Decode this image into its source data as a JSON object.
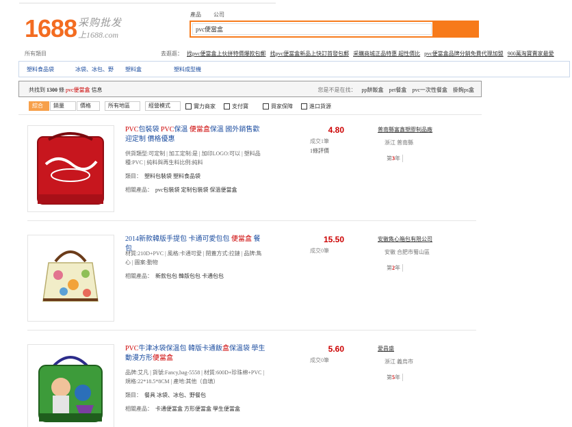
{
  "logo": {
    "number": "1688",
    "tagline": "采购批发",
    "domain": "上1688.com"
  },
  "search": {
    "tabs": [
      "產品",
      "公司"
    ],
    "query": "pvc便當盒"
  },
  "all_categories": "所有類目",
  "suggestions": {
    "label": "去逛逛：",
    "links": [
      "找pvc便當盒上伙拼特價爆款包郵",
      "找pvc便當盒新品上快訂首發包郵",
      "采購商城正品特惠 超性價比",
      "pvc便當盒品牌分銷免費代理加盟",
      "900萬淘寶賣家最愛"
    ]
  },
  "category_bar": [
    "塑料食品袋",
    "冰袋、冰包、野",
    "塑料盒",
    "塑料成型機"
  ],
  "results": {
    "prefix": "共找到",
    "count": "1300",
    "unit": "條",
    "keyword": "pvc便當盒",
    "suffix": "信息",
    "alt_label": "您是不是在找：",
    "alt_links": [
      "pp餅飯盒",
      "pet餐盒",
      "pvc一次性餐盒",
      "掛鉤ps盒"
    ]
  },
  "filters": {
    "buttons": [
      "綜合",
      "銷量",
      "價格",
      "所有地區",
      "經營模式"
    ],
    "checks": [
      "實力商家",
      "支付寶",
      "買家保障",
      "進口貨源"
    ]
  },
  "items": [
    {
      "title_parts": [
        {
          "t": "PVC",
          "hl": true
        },
        {
          "t": "包裝袋 ",
          "hl": false
        },
        {
          "t": "PVC",
          "hl": true
        },
        {
          "t": "保溫 ",
          "hl": false
        },
        {
          "t": "便當盒",
          "hl": true
        },
        {
          "t": "保溫 國外銷售歡迎定制 價格優惠",
          "hl": false
        }
      ],
      "attrs": "供貨類型:可定制 | 加工定制:是 | 加印LOGO:可以 | 塑料品種:PVC | 純料與再生料比例:純料",
      "kind_label": "類目：",
      "kind": "塑料包裝袋 塑料食品袋",
      "rel_label": "相關產品：",
      "rel": "pvc包裝袋 定制包裝袋 保溫便當盒",
      "price": "4.80",
      "deal": "成交1筆",
      "review": "1條評價",
      "company": "普南縣富鑫塑膠制品廠",
      "location": "浙江 普南縣",
      "years_prefix": "第",
      "years": "3",
      "years_suffix": "年"
    },
    {
      "title_parts": [
        {
          "t": "2014新款韓版手提包 卡通可愛包包 ",
          "hl": false
        },
        {
          "t": "便當盒",
          "hl": true
        },
        {
          "t": " 餐包",
          "hl": false
        }
      ],
      "attrs": "材質:210D+PVC | 風格:卡通可愛 | 閉蓋方式:拉鏈 | 品牌:雋心 | 圖案:動物",
      "kind_label": "",
      "kind": "",
      "rel_label": "相關產品：",
      "rel": "新款包包 韓版包包 卡通包包",
      "price": "15.50",
      "deal": "成交0筆",
      "review": "",
      "company": "安徽雋心箱包有限公司",
      "location": "安徽 合肥市蜀山區",
      "years_prefix": "第",
      "years": "2",
      "years_suffix": "年"
    },
    {
      "title_parts": [
        {
          "t": "PVC",
          "hl": true
        },
        {
          "t": "牛津冰袋保溫包 韓版卡通飯",
          "hl": false
        },
        {
          "t": "盒",
          "hl": true
        },
        {
          "t": "保溫袋 學生動漫方形",
          "hl": false
        },
        {
          "t": "便當盒",
          "hl": true
        }
      ],
      "attrs": "品牌:艾凡 | 貨號:Fancy,bag-5558 | 材質:600D+珍珠棉+PVC | 規格:22*18.5*8CM | 產地:其他（自填）",
      "kind_label": "類目：",
      "kind": "餐具 冰袋、冰包、野餐包",
      "rel_label": "相關產品：",
      "rel": "卡通便當盒 方形便當盒 學生便當盒",
      "price": "5.60",
      "deal": "成交0筆",
      "review": "",
      "company": "愛昌盛",
      "location": "浙江 義烏市",
      "years_prefix": "第",
      "years": "5",
      "years_suffix": "年"
    }
  ]
}
